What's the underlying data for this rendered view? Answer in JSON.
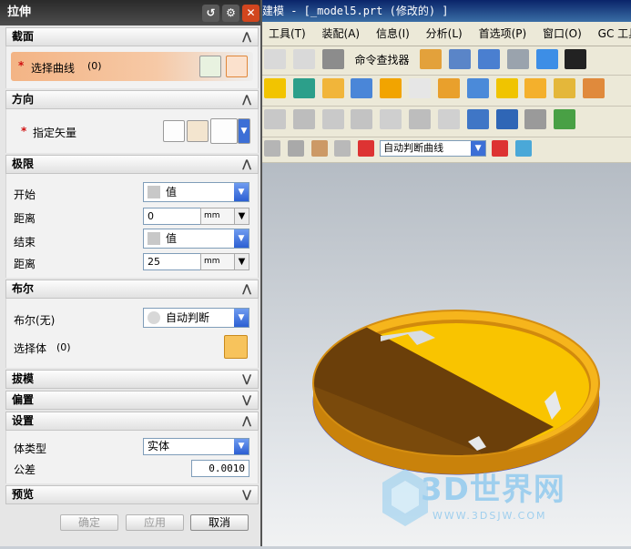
{
  "window_title_fragment": "建模 - [_model5.prt  (修改的) ]",
  "menu": [
    "工具(T)",
    "装配(A)",
    "信息(I)",
    "分析(L)",
    "首选项(P)",
    "窗口(O)",
    "GC 工具箱"
  ],
  "toolbar": {
    "find_command": "命令查找器",
    "curve_rule": "自动判断曲线"
  },
  "dialog": {
    "title": "拉伸",
    "sections": {
      "section": {
        "title": "截面",
        "select_curve_star": "*",
        "select_curve_label": "选择曲线",
        "select_curve_count": "(0)"
      },
      "direction": {
        "title": "方向",
        "specify_vector_star": "*",
        "specify_vector_label": "指定矢量"
      },
      "limits": {
        "title": "极限",
        "start_label": "开始",
        "start_type": "值",
        "start_distance_label": "距离",
        "start_distance": "0",
        "start_unit": "mm",
        "end_label": "结束",
        "end_type": "值",
        "end_distance_label": "距离",
        "end_distance": "25",
        "end_unit": "mm"
      },
      "boolean": {
        "title": "布尔",
        "boolean_label": "布尔(无)",
        "boolean_value": "自动判断",
        "select_body_label": "选择体",
        "select_body_count": "(0)"
      },
      "draft": {
        "title": "拔模"
      },
      "offset": {
        "title": "偏置"
      },
      "settings": {
        "title": "设置",
        "body_type_label": "体类型",
        "body_type_value": "实体",
        "tolerance_label": "公差",
        "tolerance_value": "0.0010"
      },
      "preview": {
        "title": "预览"
      }
    },
    "buttons": {
      "ok": "确定",
      "apply": "应用",
      "cancel": "取消"
    }
  },
  "watermark": {
    "text": "3D世界网",
    "url": "WWW.3DSJW.COM"
  },
  "colors": {
    "accent_orange": "#f0a070",
    "model_dark": "#6b3f0a",
    "model_yellow": "#f9c400",
    "model_rim": "#d18a0c"
  }
}
